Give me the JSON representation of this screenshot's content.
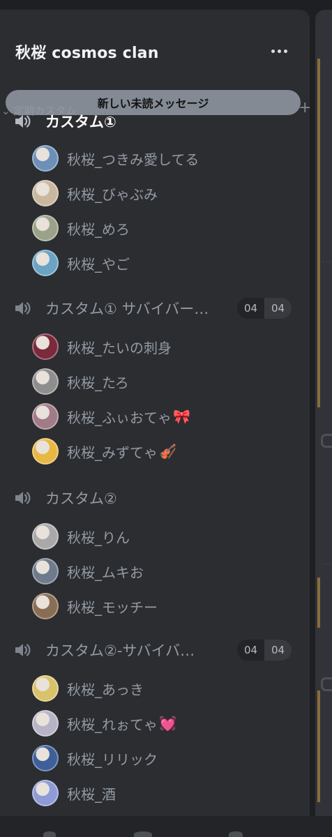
{
  "server": {
    "name": "秋桜 cosmos clan",
    "menu_icon": "more-horizontal-icon"
  },
  "category": {
    "name": "定期カスタム",
    "collapse_icon": "chevron-down-icon",
    "add_icon": "plus-icon"
  },
  "unread_banner": "新しい未読メッセージ",
  "channels": [
    {
      "name": "カスタム①",
      "icon": "speaker-icon",
      "active": true,
      "counts": null,
      "users": [
        {
          "name": "秋桜_つきみ愛してる"
        },
        {
          "name": "秋桜_びゃぶみ"
        },
        {
          "name": "秋桜_めろ"
        },
        {
          "name": "秋桜_やご"
        }
      ]
    },
    {
      "name": "カスタム① サバイバー…",
      "icon": "speaker-icon",
      "active": false,
      "counts": {
        "users": "04",
        "limit": "04"
      },
      "users": [
        {
          "name": "秋桜_たいの刺身"
        },
        {
          "name": "秋桜_たろ"
        },
        {
          "name": "秋桜_ふぃおてゃ",
          "emoji": "🎀"
        },
        {
          "name": "秋桜_みずてゃ",
          "emoji": "🎻"
        }
      ]
    },
    {
      "name": "カスタム②",
      "icon": "speaker-icon",
      "active": false,
      "counts": null,
      "users": [
        {
          "name": "秋桜_りん"
        },
        {
          "name": "秋桜_ムキお"
        },
        {
          "name": "秋桜_モッチー"
        }
      ]
    },
    {
      "name": "カスタム②-サバイバ…",
      "icon": "speaker-icon",
      "active": false,
      "counts": {
        "users": "04",
        "limit": "04"
      },
      "users": [
        {
          "name": "秋桜_あっき"
        },
        {
          "name": "秋桜_れぉてゃ",
          "emoji": "💓"
        },
        {
          "name": "秋桜_リリック"
        },
        {
          "name": "秋桜_酒"
        }
      ]
    }
  ],
  "colors": {
    "panel": "#2b2d31",
    "background": "#1e1f22",
    "text_muted": "#949ba4",
    "text_active": "#ffffff"
  }
}
